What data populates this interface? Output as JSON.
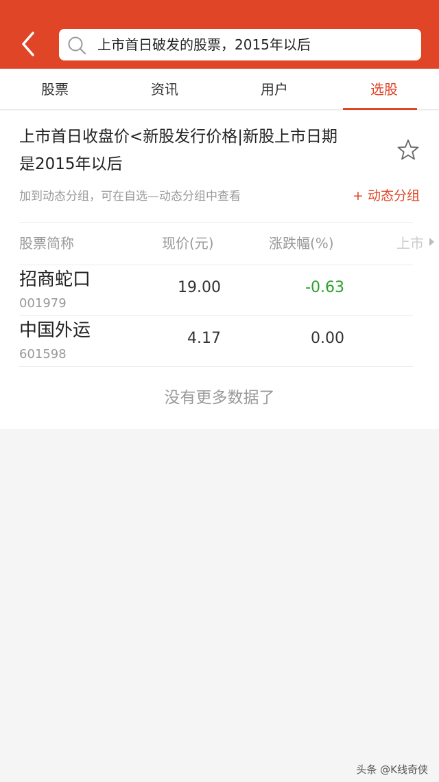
{
  "header": {
    "search_query": "上市首日破发的股票，2015年以后"
  },
  "tabs": [
    {
      "label": "股票",
      "active": false
    },
    {
      "label": "资讯",
      "active": false
    },
    {
      "label": "用户",
      "active": false
    },
    {
      "label": "选股",
      "active": true
    }
  ],
  "condition": {
    "line1": "上市首日收盘价<新股发行价格|新股上市日期",
    "line2": "是2015年以后",
    "hint": "加到动态分组，可在自选—动态分组中查看",
    "add_group": "+ 动态分组"
  },
  "table": {
    "columns": [
      "股票简称",
      "现价(元)",
      "涨跌幅(%)",
      "上市"
    ],
    "rows": [
      {
        "name": "招商蛇口",
        "code": "001979",
        "price": "19.00",
        "change": "-0.63",
        "change_color": "#2aa12a"
      },
      {
        "name": "中国外运",
        "code": "601598",
        "price": "4.17",
        "change": "0.00",
        "change_color": "#333333"
      }
    ]
  },
  "footer": {
    "no_more": "没有更多数据了"
  },
  "watermark": "头条 @K线奇侠",
  "colors": {
    "accent": "#e04527",
    "negative": "#2aa12a"
  },
  "icons": [
    "back-arrow-icon",
    "search-icon",
    "star-icon",
    "chevron-right-icon"
  ]
}
